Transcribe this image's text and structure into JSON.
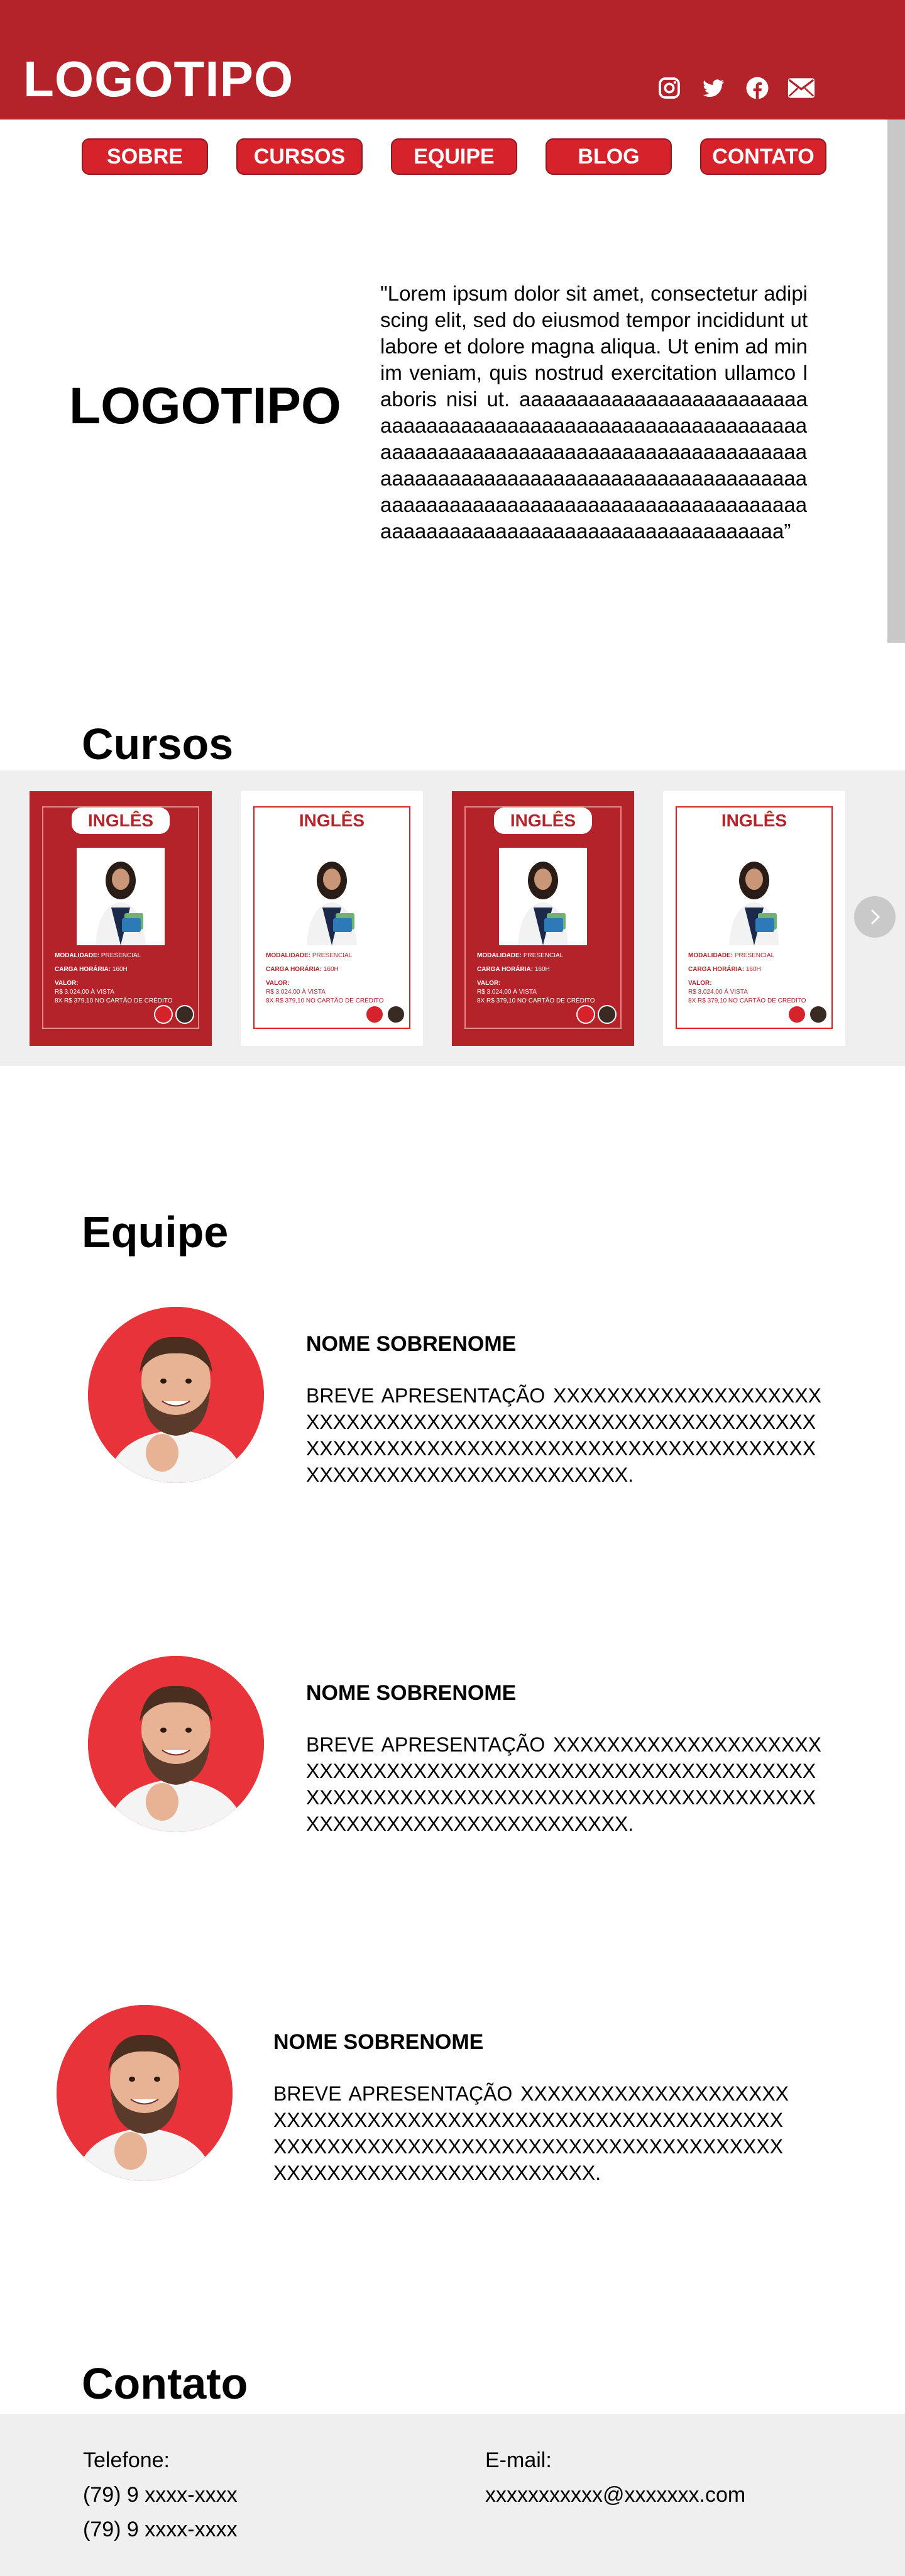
{
  "header": {
    "logo": "LOGOTIPO",
    "social_icons": [
      "instagram-icon",
      "twitter-icon",
      "facebook-icon",
      "mail-icon"
    ],
    "background": "#b4232a"
  },
  "nav": {
    "items": [
      "SOBRE",
      "CURSOS",
      "EQUIPE",
      "BLOG",
      "CONTATO"
    ],
    "button_color": "#d6232b"
  },
  "intro": {
    "logo": "LOGOTIPO",
    "text": "\"Lorem ipsum dolor sit amet, consectetur adipiscing elit, sed do eiusmod tempor incididunt ut labore et dolore magna aliqua. Ut enim ad minim veniam, quis nostrud exercitation ullamco laboris nisi ut. aaaaaaaaaaaaaaaaaaaaaaaaaaaaaaaaaaaaaaaaaaaaaaaaaaaaaaaaaaaaaaaaaaaaaaaaaaaaaaaaaaaaaaaaaaaaaaaaaaaaaaaaaaaaaaaaaaaaaaaaaaaaaaaaaaaaaaaaaaaaaaaaaaaaaaaaaaaaaaaaaaaaaaaaaaaaaaaaaaaaaaaaaaaaaaaaaaaaaaaaaaaaaaaa”"
  },
  "courses": {
    "title": "Cursos",
    "cards": [
      {
        "style": "red",
        "title": "INGLÊS",
        "modalidade_label": "MODALIDADE:",
        "modalidade": "PRESENCIAL",
        "carga_label": "CARGA HORÁRIA:",
        "carga": "160H",
        "valor_label": "VALOR:",
        "valor_1": "R$ 3.024,00 À VISTA",
        "valor_2": "8X R$ 379,10 NO CARTÃO DE CRÉDITO"
      },
      {
        "style": "white",
        "title": "INGLÊS",
        "modalidade_label": "MODALIDADE:",
        "modalidade": "PRESENCIAL",
        "carga_label": "CARGA HORÁRIA:",
        "carga": "160H",
        "valor_label": "VALOR:",
        "valor_1": "R$ 3.024,00 À VISTA",
        "valor_2": "8X R$ 379,10 NO CARTÃO DE CRÉDITO"
      },
      {
        "style": "red",
        "title": "INGLÊS",
        "modalidade_label": "MODALIDADE:",
        "modalidade": "PRESENCIAL",
        "carga_label": "CARGA HORÁRIA:",
        "carga": "160H",
        "valor_label": "VALOR:",
        "valor_1": "R$ 3.024,00 À VISTA",
        "valor_2": "8X R$ 379,10 NO CARTÃO DE CRÉDITO"
      },
      {
        "style": "white",
        "title": "INGLÊS",
        "modalidade_label": "MODALIDADE:",
        "modalidade": "PRESENCIAL",
        "carga_label": "CARGA HORÁRIA:",
        "carga": "160H",
        "valor_label": "VALOR:",
        "valor_1": "R$ 3.024,00 À VISTA",
        "valor_2": "8X R$ 379,10 NO CARTÃO DE CRÉDITO"
      }
    ],
    "next_icon": "chevron-right-icon"
  },
  "team": {
    "title": "Equipe",
    "members": [
      {
        "name": "NOME SOBRENOME",
        "text": "BREVE APRESENTAÇÃO XXXXXXXXXXXXXXXXXXXXXXXXXXXXXXXXXXXXXXXXXXXXXXXXXXXXXXXXXXXXXXXXXXXXXXXXXXXXXXXXXXXXXXXXXXXXXXXXXXXXXXXXXXXXXXXXXXXXXXXX."
      },
      {
        "name": "NOME SOBRENOME",
        "text": "BREVE APRESENTAÇÃO XXXXXXXXXXXXXXXXXXXXXXXXXXXXXXXXXXXXXXXXXXXXXXXXXXXXXXXXXXXXXXXXXXXXXXXXXXXXXXXXXXXXXXXXXXXXXXXXXXXXXXXXXXXXXXXXXXXXXXXX."
      },
      {
        "name": "NOME SOBRENOME",
        "text": "BREVE APRESENTAÇÃO XXXXXXXXXXXXXXXXXXXXXXXXXXXXXXXXXXXXXXXXXXXXXXXXXXXXXXXXXXXXXXXXXXXXXXXXXXXXXXXXXXXXXXXXXXXXXXXXXXXXXXXXXXXXXXXXXXXXXXXX."
      }
    ]
  },
  "contact": {
    "title": "Contato",
    "phone_label": "Telefone:",
    "phone_1": "(79) 9 xxxx-xxxx",
    "phone_2": "(79) 9 xxxx-xxxx",
    "email_label": "E-mail:",
    "email": "xxxxxxxxxxx@xxxxxxx.com"
  }
}
